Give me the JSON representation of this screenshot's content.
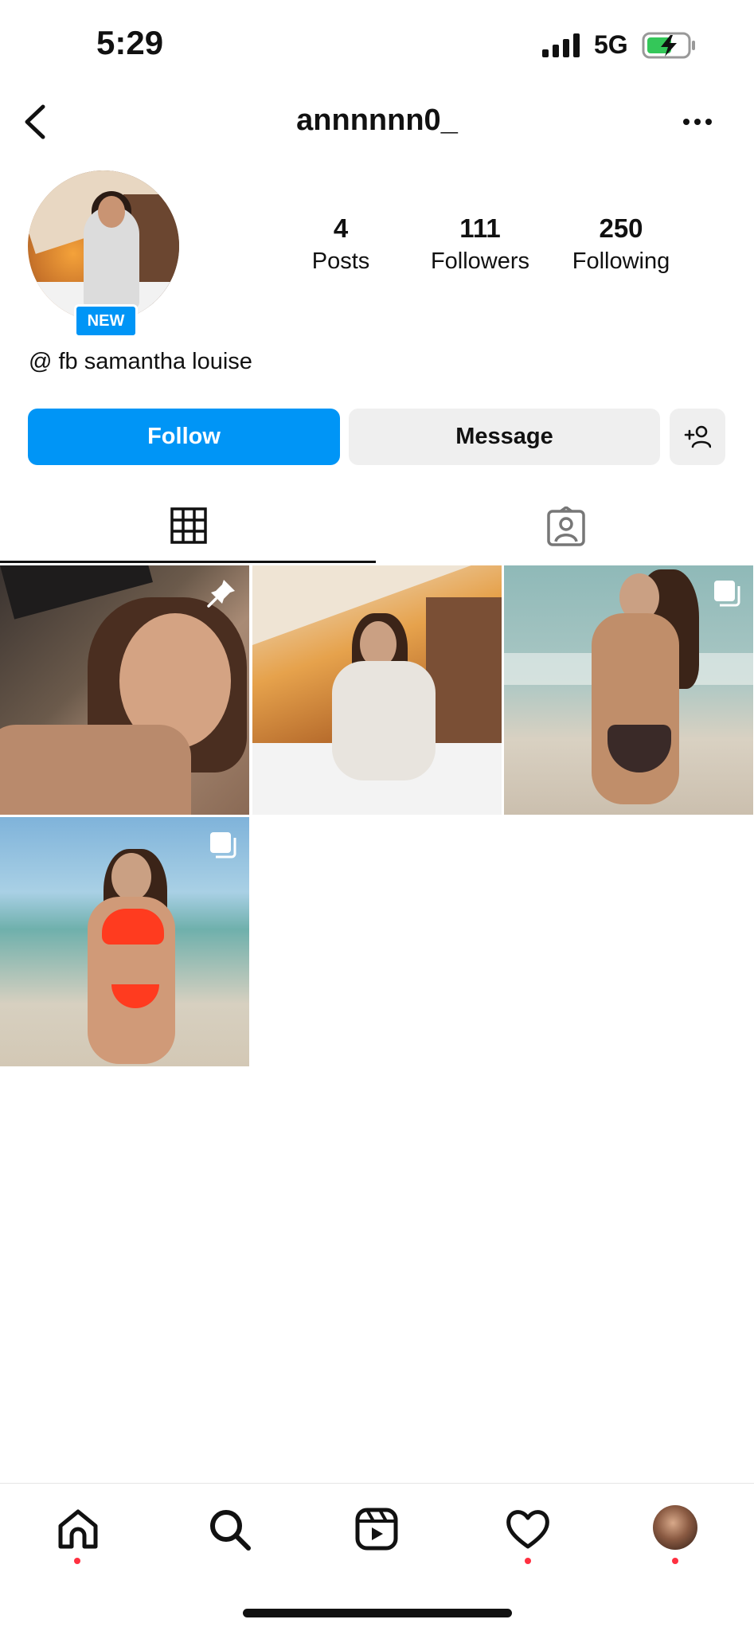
{
  "status_bar": {
    "time": "5:29",
    "network": "5G"
  },
  "header": {
    "username": "annnnnn0_",
    "icons": [
      "back-icon",
      "more-icon"
    ]
  },
  "profile": {
    "badge": "NEW",
    "bio": "@ fb samantha louise",
    "stats": [
      {
        "value": "4",
        "label": "Posts"
      },
      {
        "value": "111",
        "label": "Followers"
      },
      {
        "value": "250",
        "label": "Following"
      }
    ]
  },
  "actions": {
    "follow_label": "Follow",
    "message_label": "Message"
  },
  "tabs": [
    "grid-icon",
    "tagged-icon"
  ],
  "posts": [
    {
      "overlay_icon": "pin-icon"
    },
    {
      "overlay_icon": ""
    },
    {
      "overlay_icon": "multi-post-icon"
    },
    {
      "overlay_icon": "multi-post-icon"
    }
  ],
  "bottom_nav": [
    "home-icon",
    "search-icon",
    "reels-icon",
    "activity-icon",
    "profile-avatar"
  ],
  "colors": {
    "accent": "#0095f6",
    "notification_dot": "#ff3040"
  }
}
